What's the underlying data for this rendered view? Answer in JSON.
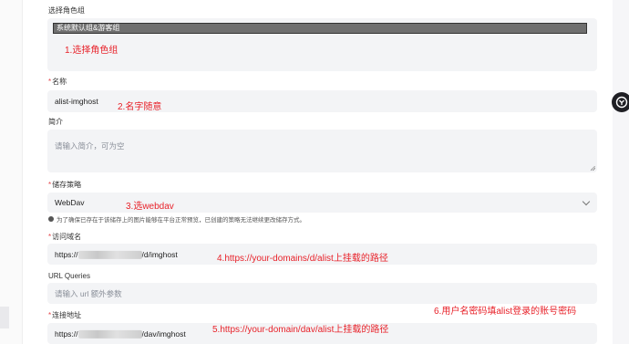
{
  "role": {
    "label": "选择角色组",
    "selected": "系统默认组&游客组",
    "annotation": "1.选择角色组"
  },
  "name": {
    "label": "名称",
    "required_mark": "*",
    "value": "alist-imghost",
    "annotation": "2.名字随意"
  },
  "intro": {
    "label": "简介",
    "placeholder": "请输入简介，可为空"
  },
  "storage": {
    "label": "储存策略",
    "required_mark": "*",
    "value": "WebDav",
    "annotation": "3.选webdav",
    "note": "为了确保已存在于该储存上的图片能够在平台正常预览，已创建的策略无法继续更改储存方式。"
  },
  "domain": {
    "label": "访问域名",
    "required_mark": "*",
    "value_prefix": "https://",
    "value_suffix": "/d/imghost",
    "annotation": "4.https://your-domains/d/alist上挂载的路径"
  },
  "url_queries": {
    "label": "URL Queries",
    "placeholder": "请输入 url 额外参数",
    "annotation": "6.用户名密码填alist登录的账号密码"
  },
  "endpoint": {
    "label": "连接地址",
    "required_mark": "*",
    "value_prefix": "https://",
    "value_suffix": "/dav/imghost",
    "annotation": "5.https://your-domain/dav/alist上挂载的路径"
  },
  "colors": {
    "annotation_red": "#e8222a",
    "required_red": "#e5484d",
    "field_bg": "#f3f4f6"
  }
}
